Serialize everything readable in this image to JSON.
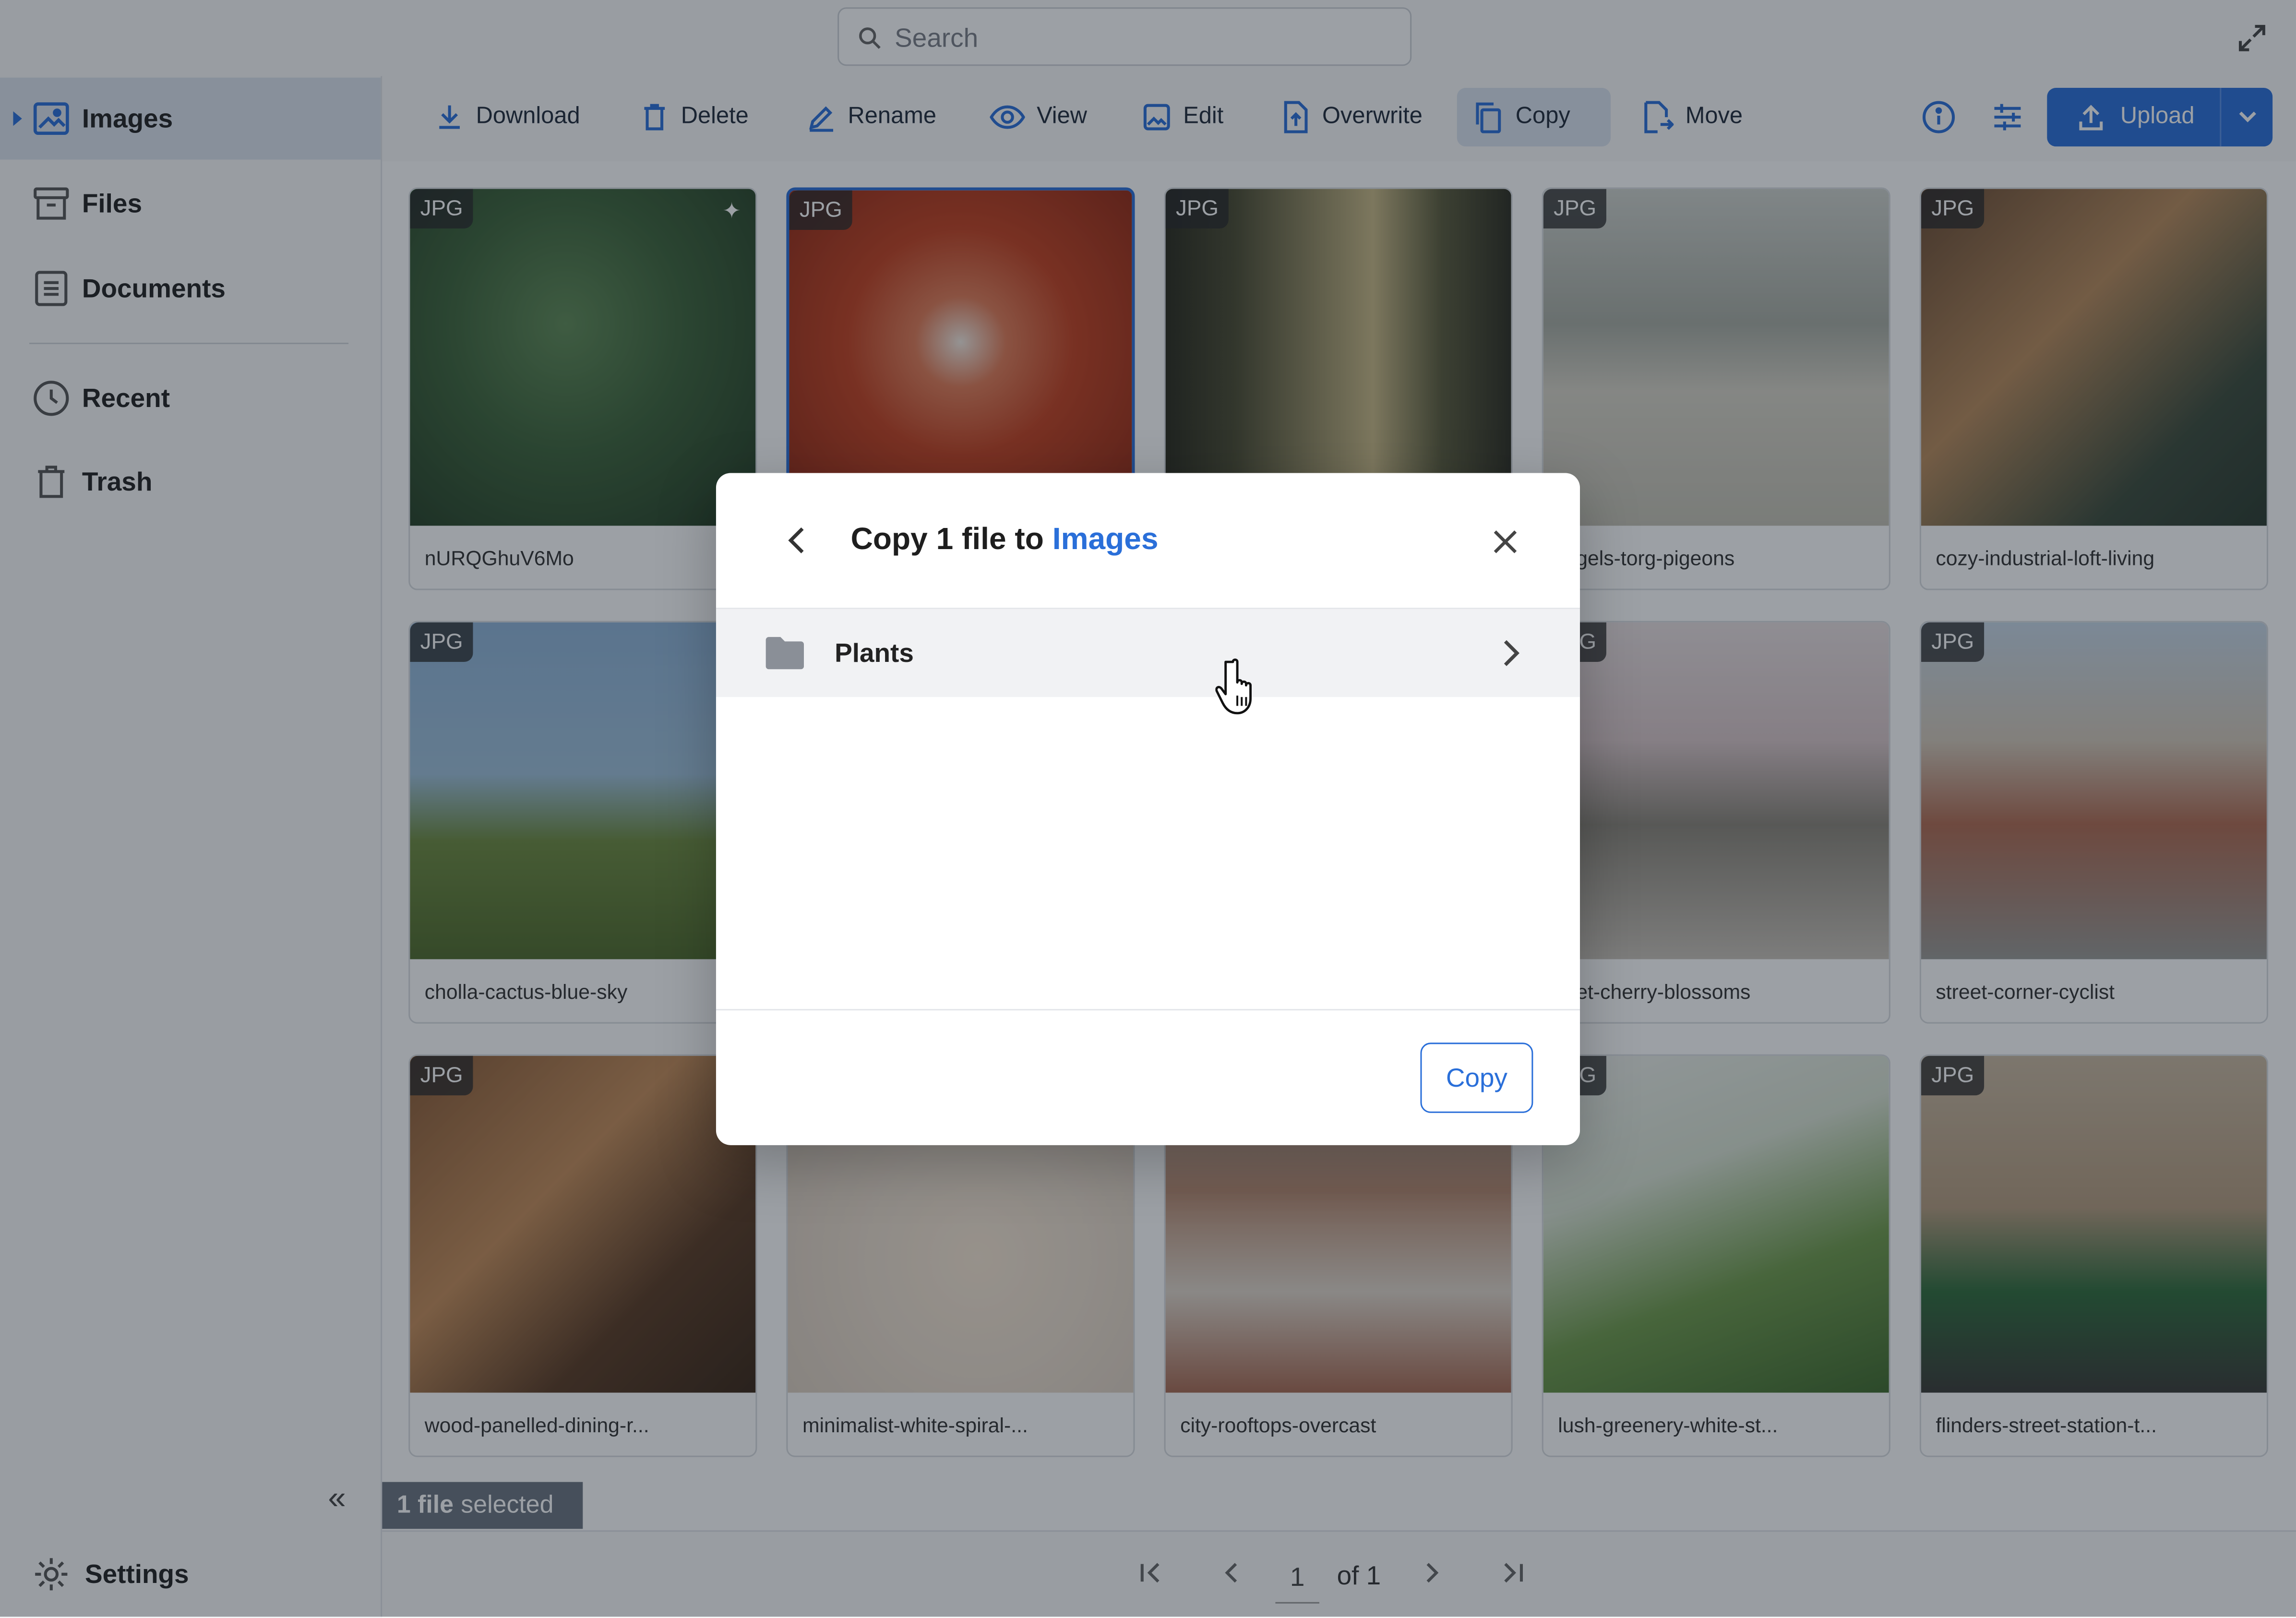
{
  "search": {
    "placeholder": "Search"
  },
  "sidebar": {
    "items": [
      {
        "label": "Images",
        "icon": "image-icon",
        "active": true
      },
      {
        "label": "Files",
        "icon": "archive-icon"
      },
      {
        "label": "Documents",
        "icon": "document-icon"
      },
      {
        "label": "Recent",
        "icon": "clock-icon"
      },
      {
        "label": "Trash",
        "icon": "trash-icon"
      }
    ],
    "settings_label": "Settings",
    "collapse_glyph": "«"
  },
  "toolbar": {
    "download": "Download",
    "delete": "Delete",
    "rename": "Rename",
    "view": "View",
    "edit": "Edit",
    "overwrite": "Overwrite",
    "copy": "Copy",
    "move": "Move",
    "upload": "Upload"
  },
  "grid": {
    "badge": "JPG",
    "items": [
      {
        "name": "nURQGhuV6Mo"
      },
      {
        "name": ""
      },
      {
        "name": ""
      },
      {
        "name": "ergels-torg-pigeons"
      },
      {
        "name": "cozy-industrial-loft-living"
      },
      {
        "name": "cholla-cactus-blue-sky"
      },
      {
        "name": ""
      },
      {
        "name": ""
      },
      {
        "name": "reet-cherry-blossoms"
      },
      {
        "name": "street-corner-cyclist"
      },
      {
        "name": "wood-panelled-dining-r..."
      },
      {
        "name": "minimalist-white-spiral-..."
      },
      {
        "name": "city-rooftops-overcast"
      },
      {
        "name": "lush-greenery-white-st..."
      },
      {
        "name": "flinders-street-station-t..."
      }
    ]
  },
  "selection": {
    "count": "1 file",
    "suffix": "selected"
  },
  "pager": {
    "page": "1",
    "of": "of 1"
  },
  "modal": {
    "title_prefix": "Copy 1 file to",
    "title_link": "Images",
    "folder": "Plants",
    "copy_button": "Copy"
  },
  "colors": {
    "accent": "#2a6fd9",
    "overlay": "rgba(20,28,40,0.42)"
  }
}
